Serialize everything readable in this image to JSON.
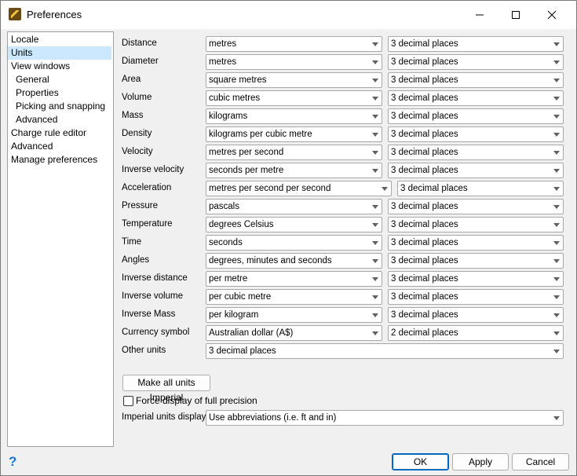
{
  "window": {
    "title": "Preferences",
    "minimize_label": "—",
    "maximize_label": "☐",
    "close_label": "✕"
  },
  "sidebar": {
    "items": [
      {
        "label": "Locale",
        "indent": 0,
        "selected": false
      },
      {
        "label": "Units",
        "indent": 0,
        "selected": true
      },
      {
        "label": "View windows",
        "indent": 0,
        "selected": false
      },
      {
        "label": "General",
        "indent": 1,
        "selected": false
      },
      {
        "label": "Properties",
        "indent": 1,
        "selected": false
      },
      {
        "label": "Picking and snapping",
        "indent": 1,
        "selected": false
      },
      {
        "label": "Advanced",
        "indent": 1,
        "selected": false
      },
      {
        "label": "Charge rule editor",
        "indent": 0,
        "selected": false
      },
      {
        "label": "Advanced",
        "indent": 0,
        "selected": false
      },
      {
        "label": "Manage preferences",
        "indent": 0,
        "selected": false
      }
    ]
  },
  "units": [
    {
      "label": "Distance",
      "unit": "metres",
      "precision": "3 decimal places"
    },
    {
      "label": "Diameter",
      "unit": "metres",
      "precision": "3 decimal places"
    },
    {
      "label": "Area",
      "unit": "square metres",
      "precision": "3 decimal places"
    },
    {
      "label": "Volume",
      "unit": "cubic metres",
      "precision": "3 decimal places"
    },
    {
      "label": "Mass",
      "unit": "kilograms",
      "precision": "3 decimal places"
    },
    {
      "label": "Density",
      "unit": "kilograms per cubic metre",
      "precision": "3 decimal places"
    },
    {
      "label": "Velocity",
      "unit": "metres per second",
      "precision": "3 decimal places"
    },
    {
      "label": "Inverse velocity",
      "unit": "seconds per metre",
      "precision": "3 decimal places"
    },
    {
      "label": "Acceleration",
      "unit": "metres per second per second",
      "precision": "3 decimal places"
    },
    {
      "label": "Pressure",
      "unit": "pascals",
      "precision": "3 decimal places"
    },
    {
      "label": "Temperature",
      "unit": "degrees Celsius",
      "precision": "3 decimal places"
    },
    {
      "label": "Time",
      "unit": "seconds",
      "precision": "3 decimal places"
    },
    {
      "label": "Angles",
      "unit": "degrees, minutes and seconds",
      "precision": "3 decimal places"
    },
    {
      "label": "Inverse distance",
      "unit": "per metre",
      "precision": "3 decimal places"
    },
    {
      "label": "Inverse volume",
      "unit": "per cubic metre",
      "precision": "3 decimal places"
    },
    {
      "label": "Inverse Mass",
      "unit": "per kilogram",
      "precision": "3 decimal places"
    },
    {
      "label": "Currency symbol",
      "unit": "Australian dollar (A$)",
      "precision": "2 decimal places"
    }
  ],
  "other_units": {
    "label": "Other units",
    "value": "3 decimal places"
  },
  "make_imperial_label": "Make all units Imperial",
  "force_precision": {
    "label": "Force display of full precision",
    "checked": false
  },
  "imperial_display": {
    "label": "Imperial units display",
    "value": "Use abbreviations (i.e. ft and in)"
  },
  "buttons": {
    "ok": "OK",
    "apply": "Apply",
    "cancel": "Cancel"
  },
  "help_label": "?"
}
